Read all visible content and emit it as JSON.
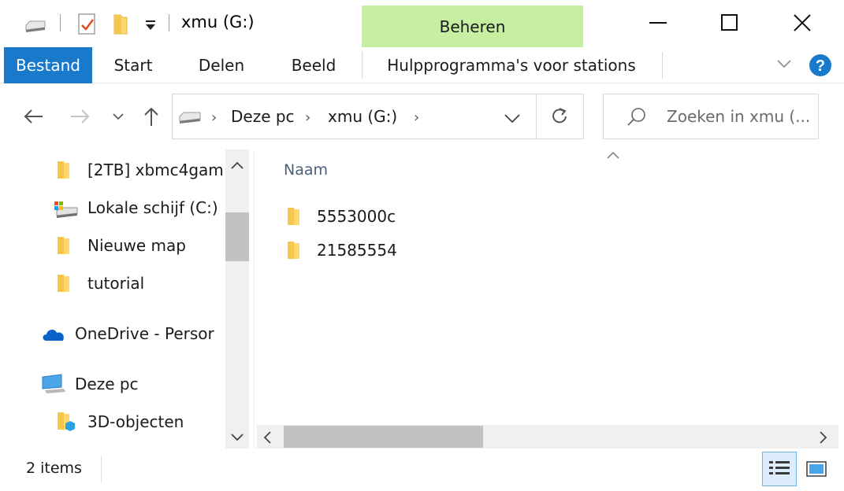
{
  "window": {
    "title": "xmu (G:)",
    "context_tab": "Beheren"
  },
  "ribbon": {
    "tabs": [
      "Bestand",
      "Start",
      "Delen",
      "Beeld",
      "Hulpprogramma's voor stations"
    ]
  },
  "address": {
    "crumbs": [
      "Deze pc",
      "xmu (G:)"
    ]
  },
  "search": {
    "placeholder": "Zoeken in xmu (..."
  },
  "navigation": {
    "items": [
      "[2TB] xbmc4gam",
      "Lokale schijf (C:)",
      "Nieuwe map",
      "tutorial",
      "OneDrive - Persor",
      "Deze pc",
      "3D-objecten"
    ]
  },
  "content": {
    "column_name": "Naam",
    "files": [
      "5553000c",
      "21585554"
    ]
  },
  "status": {
    "count": "2 items"
  },
  "colors": {
    "accent": "#1979ca",
    "context_tab_bg": "#c6efa1",
    "help_blue": "#1979ca",
    "folder_yellow": "#ffd76a"
  }
}
